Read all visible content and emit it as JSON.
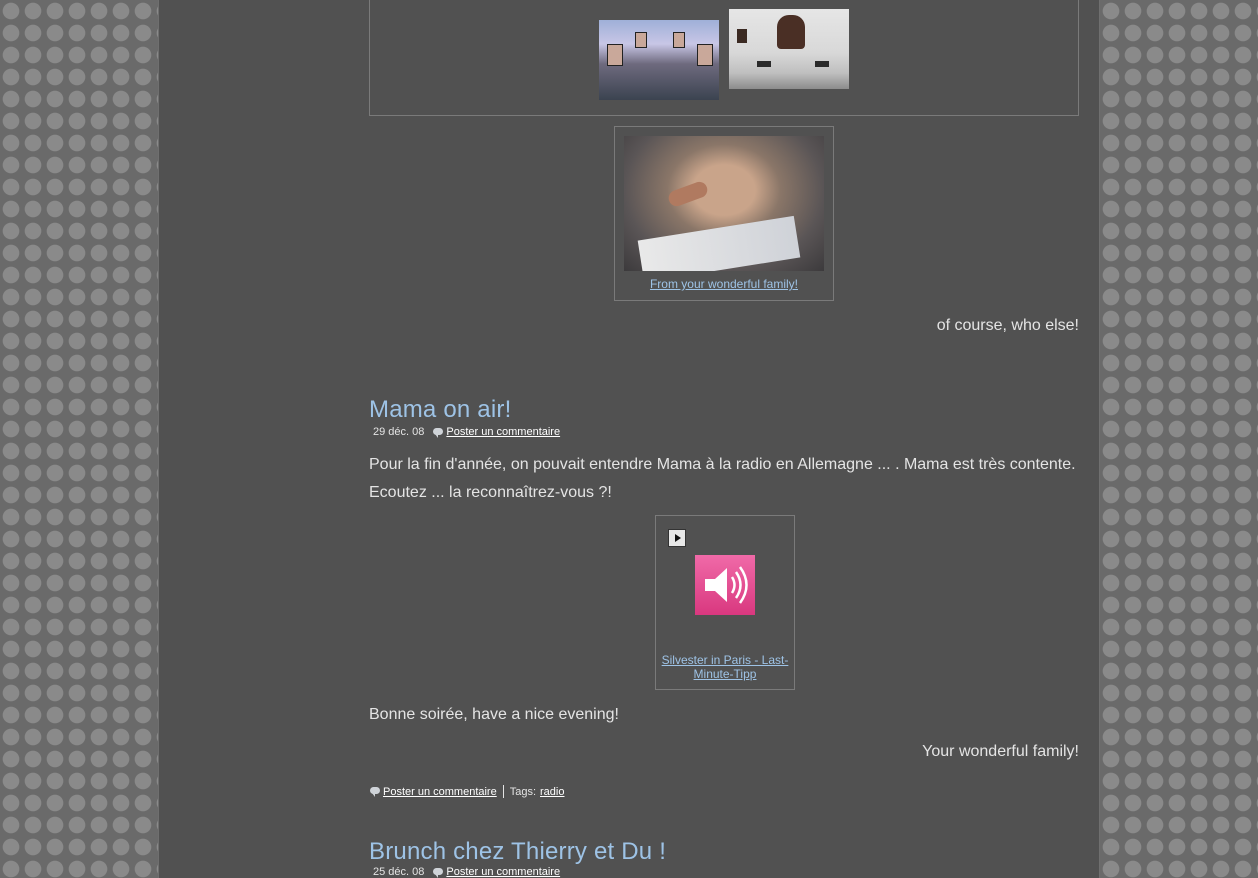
{
  "gallery": {
    "thumbnails": [
      "mall-thumbnail",
      "museum-thumbnail"
    ]
  },
  "photo": {
    "caption": "From your wonderful family!"
  },
  "post0": {
    "closing": "of course, who else!"
  },
  "post1": {
    "title": "Mama on air!",
    "date": "29 déc. 08",
    "comment_link": "Poster un commentaire",
    "paragraph1": "Pour la fin d'année, on pouvait entendre Mama à la radio en Allemagne ... . Mama est très contente.",
    "paragraph2": "Ecoutez ... la reconnaîtrez-vous ?!",
    "audio": {
      "caption": "Silvester in Paris - Last-Minute-Tipp"
    },
    "greeting": "Bonne soirée, have a nice evening!",
    "signature": "Your wonderful family!",
    "footer": {
      "comment_link": "Poster un commentaire",
      "tags_label": "Tags:",
      "tag": "radio"
    }
  },
  "post2": {
    "title": "Brunch chez Thierry et Du !",
    "date": "25 déc. 08",
    "comment_link": "Poster un commentaire"
  },
  "colors": {
    "page_bg": "#515151",
    "body_bg": "#6a6a6a",
    "title": "#9ec3e6",
    "caption_link": "#9ec3e6",
    "text": "#e4e4e4",
    "audio_tile": "#e04f92"
  }
}
